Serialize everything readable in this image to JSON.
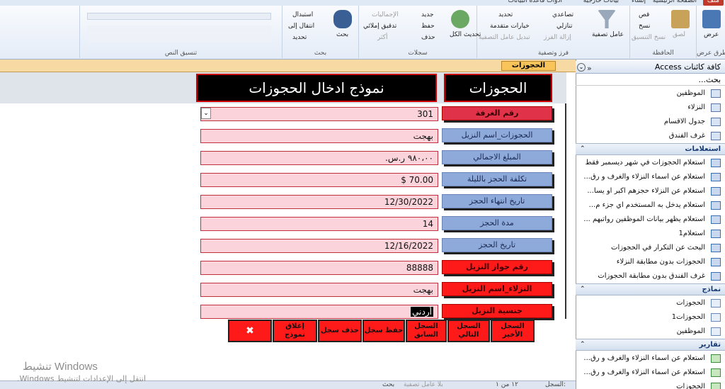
{
  "ribbon": {
    "tabs": [
      "ملف",
      "الصفحة الرئيسية",
      "إنشاء",
      "بيانات خارجية",
      "أدوات قاعدة البيانات"
    ],
    "groups": {
      "views": {
        "label": "طرق عرض",
        "view": "عرض"
      },
      "clipboard": {
        "label": "الحافظة",
        "paste": "لصق",
        "cut": "قص",
        "copy": "نسخ",
        "format_painter": "نسخ التنسيق"
      },
      "sort_filter": {
        "label": "فرز وتصفية",
        "filter": "عامل تصفية",
        "ascending": "تصاعدي",
        "descending": "تنازلي",
        "remove_sort": "إزالة الفرز",
        "selection": "تحديد",
        "advanced": "خيارات متقدمة",
        "toggle_filter": "تبديل عامل التصفية"
      },
      "records": {
        "label": "سجلات",
        "refresh_all": "تحديث الكل",
        "new": "جديد",
        "save": "حفظ",
        "delete": "حذف",
        "totals": "الإجماليات",
        "spelling": "تدقيق إملائي",
        "more": "أكثر"
      },
      "find": {
        "label": "بحث",
        "find": "بحث",
        "replace": "استبدال",
        "goto": "انتقال إلى",
        "select": "تحديد"
      },
      "text_format": {
        "label": "تنسيق النص"
      }
    }
  },
  "form_tab": {
    "label": "الحجوزات"
  },
  "form_header": {
    "title": "الحجوزات",
    "subtitle": "نموذج ادخال الحجوزات"
  },
  "fields": [
    {
      "label": "رقم الغرفة",
      "value": "301",
      "style": "crimson",
      "has_combo": true
    },
    {
      "label": "الحجوزات_اسم النزيل",
      "value": "بهجت",
      "style": "blue"
    },
    {
      "label": "المبلغ الاجمالي",
      "value": "٩٨٠،٠٠ ر.س.",
      "style": "blue"
    },
    {
      "label": "تكلفة الحجز بالليلة",
      "value": "$ 70.00",
      "style": "blue",
      "ltr": true
    },
    {
      "label": "تاريخ انتهاء الحجز",
      "value": "12/30/2022",
      "style": "blue",
      "ltr": true
    },
    {
      "label": "مدة الحجز",
      "value": "14",
      "style": "blue",
      "ltr": true
    },
    {
      "label": "تاريخ الحجز",
      "value": "12/16/2022",
      "style": "blue",
      "ltr": true
    },
    {
      "label": "رقم جواز النزيل",
      "value": "88888",
      "style": "red",
      "ltr": true
    },
    {
      "label": "النزلاء_اسم النزيل",
      "value": "بهجت",
      "style": "red"
    },
    {
      "label": "جنسية النزيل",
      "value": "أردني",
      "style": "red",
      "selected": true
    }
  ],
  "commands": [
    {
      "name": "last-record-button",
      "label": "السجل الأخير"
    },
    {
      "name": "next-record-button",
      "label": "السجل التالي"
    },
    {
      "name": "previous-record-button",
      "label": "السجل السابق"
    },
    {
      "name": "save-record-button",
      "label": "حفظ سجل"
    },
    {
      "name": "delete-record-button",
      "label": "حذف سجل"
    },
    {
      "name": "close-form-button",
      "label": "إغلاق نموذج"
    },
    {
      "name": "exit-button",
      "label": "✖"
    }
  ],
  "status": {
    "record_label": "السجل:",
    "record_pos": "١٢ من ١",
    "filter": "بلا عامل تصفية",
    "search": "بحث"
  },
  "watermark": {
    "line1": "تنشيط Windows",
    "line2": "انتقل إلى الإعدادات لتنشيط Windows."
  },
  "nav": {
    "title": "كافة كائنات Access",
    "search": "بحث...",
    "tables": [
      "الموظفين",
      "النزلاء",
      "جدول الاقسام",
      "غرف الفندق"
    ],
    "queries_label": "استعلامات",
    "queries": [
      "استعلام الحجوزات في شهر ديسمبر فقط",
      "استعلام عن اسماء النزلاء والغرف و رق...",
      "استعلام عن النزلاء حجزهم اكبر او يسا...",
      "استعلام يدخل به المستخدم اي جزء م...",
      "استعلام يظهر بيانات الموظفين رواتبهم ...",
      "استعلام1",
      "البحث عن التكرار في الحجوزات",
      "الحجوزات بدون مطابقة النزلاء",
      "غرف الفندق بدون مطابقة الحجوزات"
    ],
    "forms_label": "نماذج",
    "forms": [
      "الحجوزات",
      "الحجوزات1",
      "الموظفين"
    ],
    "reports_label": "تقارير",
    "reports": [
      "استعلام عن اسماء النزلاء والغرف و رق...",
      "استعلام عن اسماء النزلاء والغرف و رق...",
      "الحجوزات"
    ]
  }
}
